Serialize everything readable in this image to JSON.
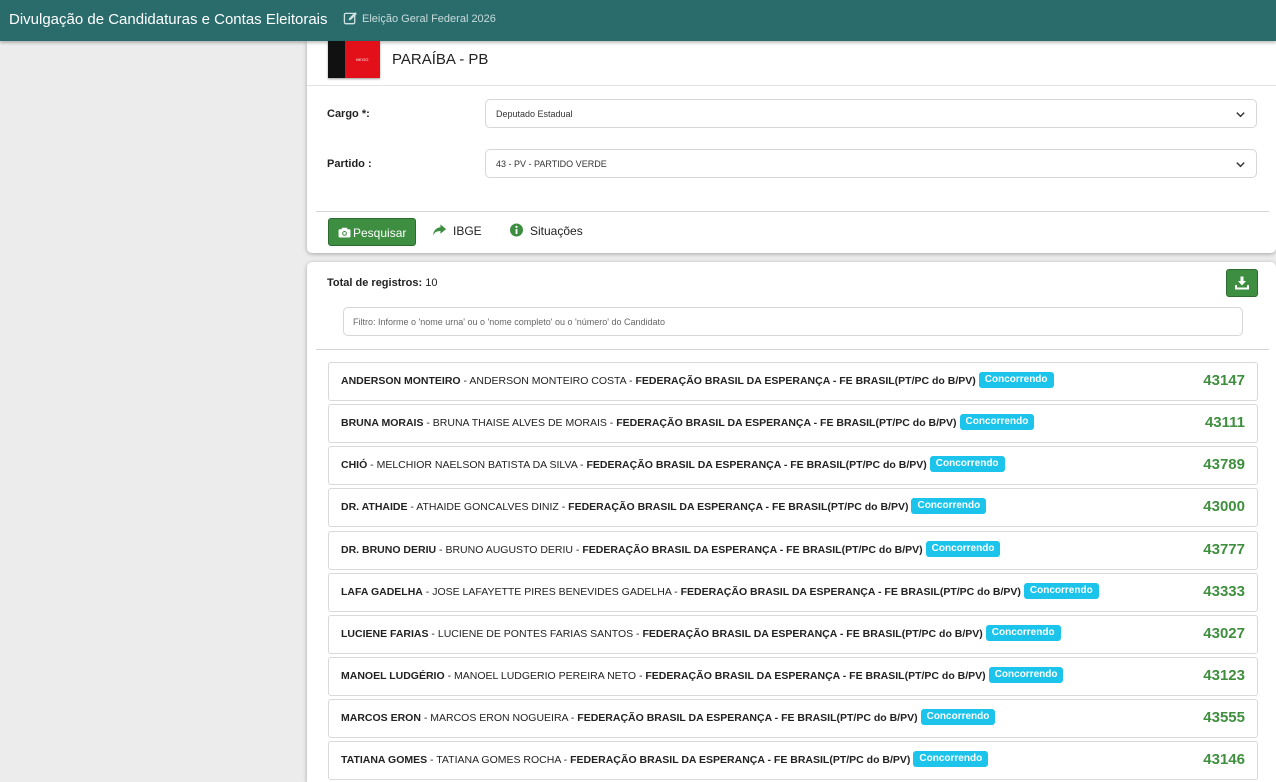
{
  "header": {
    "title": "Divulgação de Candidaturas e Contas Eleitorais",
    "election": "Eleição Geral Federal 2026"
  },
  "state": {
    "name": "PARAÍBA - PB",
    "flag_text": "NEGO"
  },
  "form": {
    "cargo_label": "Cargo *:",
    "cargo_value": "Deputado Estadual",
    "partido_label": "Partido :",
    "partido_value": "43 - PV - PARTIDO VERDE"
  },
  "actions": {
    "search": "Pesquisar",
    "ibge": "IBGE",
    "situacoes": "Situações"
  },
  "results": {
    "total_label": "Total de registros:",
    "total_value": "10",
    "filter_placeholder": "Filtro: Informe o 'nome urna' ou o 'nome completo' ou o 'número' do Candidato",
    "candidates": [
      {
        "urna": "ANDERSON MONTEIRO",
        "nome": "ANDERSON MONTEIRO COSTA",
        "federacao": "FEDERAÇÃO BRASIL DA ESPERANÇA - FE BRASIL(PT/PC do B/PV)",
        "status": "Concorrendo",
        "numero": "43147"
      },
      {
        "urna": "BRUNA MORAIS",
        "nome": "BRUNA THAISE ALVES DE MORAIS",
        "federacao": "FEDERAÇÃO BRASIL DA ESPERANÇA - FE BRASIL(PT/PC do B/PV)",
        "status": "Concorrendo",
        "numero": "43111"
      },
      {
        "urna": "CHIÓ",
        "nome": "MELCHIOR NAELSON BATISTA DA SILVA",
        "federacao": "FEDERAÇÃO BRASIL DA ESPERANÇA - FE BRASIL(PT/PC do B/PV)",
        "status": "Concorrendo",
        "numero": "43789"
      },
      {
        "urna": "DR. ATHAIDE",
        "nome": "ATHAIDE GONCALVES DINIZ",
        "federacao": "FEDERAÇÃO BRASIL DA ESPERANÇA - FE BRASIL(PT/PC do B/PV)",
        "status": "Concorrendo",
        "numero": "43000"
      },
      {
        "urna": "DR. BRUNO DERIU",
        "nome": "BRUNO AUGUSTO DERIU",
        "federacao": "FEDERAÇÃO BRASIL DA ESPERANÇA - FE BRASIL(PT/PC do B/PV)",
        "status": "Concorrendo",
        "numero": "43777"
      },
      {
        "urna": "LAFA GADELHA",
        "nome": "JOSE LAFAYETTE PIRES BENEVIDES GADELHA",
        "federacao": "FEDERAÇÃO BRASIL DA ESPERANÇA - FE BRASIL(PT/PC do B/PV)",
        "status": "Concorrendo",
        "numero": "43333"
      },
      {
        "urna": "LUCIENE FARIAS",
        "nome": "LUCIENE DE PONTES FARIAS SANTOS",
        "federacao": "FEDERAÇÃO BRASIL DA ESPERANÇA - FE BRASIL(PT/PC do B/PV)",
        "status": "Concorrendo",
        "numero": "43027"
      },
      {
        "urna": "MANOEL LUDGÉRIO",
        "nome": "MANOEL LUDGERIO PEREIRA NETO",
        "federacao": "FEDERAÇÃO BRASIL DA ESPERANÇA - FE BRASIL(PT/PC do B/PV)",
        "status": "Concorrendo",
        "numero": "43123"
      },
      {
        "urna": "MARCOS ERON",
        "nome": "MARCOS ERON NOGUEIRA",
        "federacao": "FEDERAÇÃO BRASIL DA ESPERANÇA - FE BRASIL(PT/PC do B/PV)",
        "status": "Concorrendo",
        "numero": "43555"
      },
      {
        "urna": "TATIANA GOMES",
        "nome": "TATIANA GOMES ROCHA",
        "federacao": "FEDERAÇÃO BRASIL DA ESPERANÇA - FE BRASIL(PT/PC do B/PV)",
        "status": "Concorrendo",
        "numero": "43146"
      }
    ]
  },
  "colors": {
    "header_bg": "#2a6b6c",
    "button_green": "#3e8e41",
    "number_green": "#3f8f3f",
    "badge_cyan": "#1cc4ec"
  }
}
